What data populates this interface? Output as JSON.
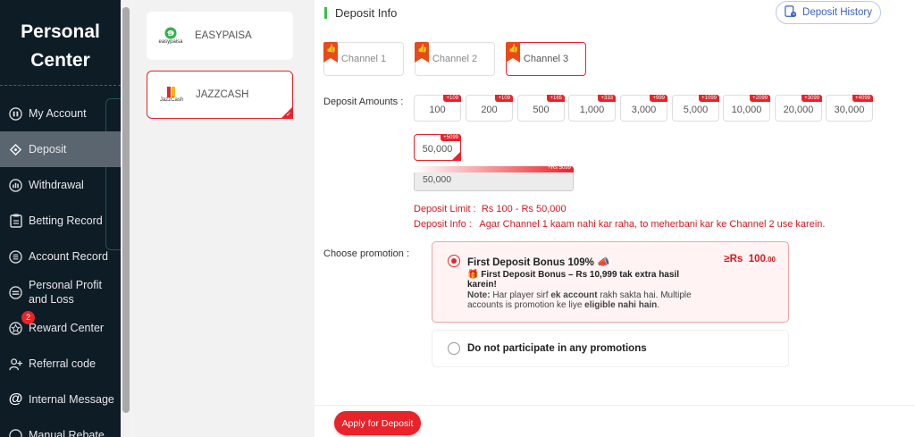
{
  "sidebar": {
    "title": "Personal Center",
    "items": [
      {
        "label": "My Account",
        "icon": "account-icon"
      },
      {
        "label": "Deposit",
        "icon": "deposit-icon"
      },
      {
        "label": "Withdrawal",
        "icon": "withdrawal-icon"
      },
      {
        "label": "Betting Record",
        "icon": "betting-record-icon"
      },
      {
        "label": "Account Record",
        "icon": "account-record-icon"
      },
      {
        "label": "Personal Profit and Loss",
        "icon": "profit-loss-icon"
      },
      {
        "label": "Reward Center",
        "icon": "reward-icon"
      },
      {
        "label": "Referral code",
        "icon": "referral-icon"
      },
      {
        "label": "Internal Message",
        "icon": "message-icon"
      },
      {
        "label": "Manual Rebate",
        "icon": "rebate-icon"
      }
    ],
    "reward_badge": "2"
  },
  "methods": [
    {
      "label": "EASYPAISA",
      "logo_text": "easypaisa"
    },
    {
      "label": "JAZZCASH",
      "logo_text": "JazzCash"
    }
  ],
  "main": {
    "title": "Deposit Info",
    "history_button": "Deposit History",
    "channels": [
      "Channel 1",
      "Channel 2",
      "Channel 3"
    ],
    "amounts_label": "Deposit Amounts :",
    "amounts": [
      {
        "value": "100",
        "bonus": "+109"
      },
      {
        "value": "200",
        "bonus": "+109"
      },
      {
        "value": "500",
        "bonus": "+165"
      },
      {
        "value": "1,000",
        "bonus": "+333"
      },
      {
        "value": "3,000",
        "bonus": "+999"
      },
      {
        "value": "5,000",
        "bonus": "+1099"
      },
      {
        "value": "10,000",
        "bonus": "+2099"
      },
      {
        "value": "20,000",
        "bonus": "+3099"
      },
      {
        "value": "30,000",
        "bonus": "+4099"
      },
      {
        "value": "50,000",
        "bonus": "+5099"
      }
    ],
    "input_value": "50,000",
    "input_bonus": "+Rs 5099",
    "limit_label": "Deposit Limit :",
    "limit_value": "Rs 100 - Rs 50,000",
    "info_label": "Deposit Info :",
    "info_value": "Agar Channel 1 kaam nahi kar raha, to meherbani kar ke Channel 2 use karein.",
    "promotion_label": "Choose promotion :",
    "promo1": {
      "title": "First Deposit Bonus 109%",
      "min_prefix": "≥Rs",
      "min_value": "100",
      "min_decimals": ".00",
      "desc_a": "First Deposit Bonus – Rs 10,999 tak extra hasil karein!",
      "note_label": "Note:",
      "note_a": " Har player sirf ",
      "note_b": "ek account",
      "note_c": " rakh sakta hai. Multiple accounts is promotion ke liye ",
      "note_d": "eligible nahi hain",
      "note_e": "."
    },
    "promo2": {
      "title": "Do not participate in any promotions"
    },
    "apply_button": "Apply for Deposit"
  },
  "colors": {
    "accent": "#e8232a",
    "sidebar_bg": "#0e1c26",
    "link": "#3a62c5"
  }
}
